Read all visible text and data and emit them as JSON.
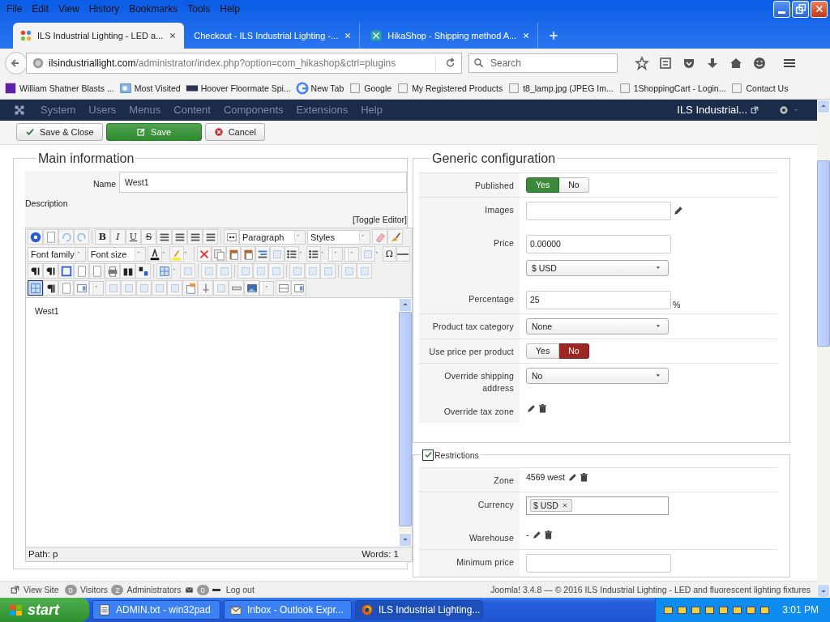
{
  "browser": {
    "menu": [
      "File",
      "Edit",
      "View",
      "History",
      "Bookmarks",
      "Tools",
      "Help"
    ],
    "tabs": [
      {
        "title": "ILS Industrial Lighting - LED a...",
        "kind": "joomla",
        "selected": true
      },
      {
        "title": "Checkout - ILS Industrial Lighting -...",
        "kind": "blank",
        "selected": false
      },
      {
        "title": "HikaShop - Shipping method A...",
        "kind": "hikashop",
        "selected": false
      }
    ],
    "url_host": "ilsindustriallight.com",
    "url_path": "/administrator/index.php?option=com_hikashop&ctrl=plugins",
    "search_placeholder": "Search",
    "bookmarks": [
      {
        "label": "William Shatner Blasts ...",
        "kind": "yahoo"
      },
      {
        "label": "Most Visited",
        "kind": "folder"
      },
      {
        "label": "Hoover Floormate Spi...",
        "kind": "hoover"
      },
      {
        "label": "New Tab",
        "kind": "google"
      },
      {
        "label": "Google",
        "kind": "blank"
      },
      {
        "label": "My Registered Products",
        "kind": "blank"
      },
      {
        "label": "t8_lamp.jpg (JPEG Im...",
        "kind": "blank"
      },
      {
        "label": "1ShoppingCart - Login...",
        "kind": "blank"
      },
      {
        "label": "Contact Us",
        "kind": "blank"
      }
    ]
  },
  "admin": {
    "menu": [
      "System",
      "Users",
      "Menus",
      "Content",
      "Components",
      "Extensions",
      "Help"
    ],
    "site_link": "ILS Industrial..."
  },
  "toolbar": [
    {
      "label": "Save & Close",
      "kind": "save-close"
    },
    {
      "label": "Save",
      "kind": "save"
    },
    {
      "label": "Cancel",
      "kind": "cancel"
    }
  ],
  "main": {
    "legend": "Main information",
    "name_label": "Name",
    "name_value": "West1",
    "description_label": "Description",
    "toggle_editor": "[Toggle Editor]",
    "editor": {
      "glyphs": [
        "B",
        "I",
        "U",
        "S",
        "Ω"
      ],
      "selects": [
        "Paragraph",
        "Styles",
        "Font family",
        "Font size"
      ],
      "visual_aid_on": true,
      "content": "West1",
      "path": "Path: p",
      "words": "Words: 1"
    }
  },
  "generic": {
    "legend": "Generic configuration",
    "groups": [
      [
        {
          "label": "Published",
          "kind": "toggle",
          "options": [
            {
              "label": "Yes",
              "selected": true
            },
            {
              "label": "No",
              "selected": false
            }
          ]
        }
      ],
      [
        {
          "label": "Images",
          "kind": "image-input"
        },
        {
          "label": "Price",
          "kind": "price",
          "value": "0.00000",
          "currency": "$ USD"
        },
        {
          "label": "Percentage",
          "kind": "input",
          "value": "25",
          "suffix": "%"
        }
      ],
      [
        {
          "label": "Product tax category",
          "kind": "select",
          "value": "None"
        }
      ],
      [
        {
          "label": "Use price per product",
          "kind": "toggle",
          "options": [
            {
              "label": "Yes",
              "selected": false
            },
            {
              "label": "No",
              "selected": true
            }
          ]
        }
      ],
      [
        {
          "label": "Override shipping address",
          "kind": "select",
          "value": "No"
        },
        {
          "label": "Override tax zone",
          "kind": "actions"
        }
      ]
    ]
  },
  "restrictions": {
    "label": "Restrictions",
    "checked": true,
    "groups": [
      [
        {
          "label": "Zone",
          "kind": "actions",
          "value": "4569 west"
        }
      ],
      [
        {
          "label": "Currency",
          "kind": "tags",
          "tags": [
            "$ USD"
          ]
        },
        {
          "label": "Warehouse",
          "kind": "actions",
          "value": "-"
        }
      ],
      [
        {
          "label": "Minimum price",
          "kind": "input"
        }
      ]
    ]
  },
  "footer": {
    "view_site": "View Site",
    "visitors_count": "0",
    "visitors": "Visitors",
    "admins_count": "2",
    "admins": "Administrators",
    "messages_count": "0",
    "logout": "Log out",
    "credits": "Joomla! 3.4.8  —  © 2016 ILS Industrial Lighting - LED and fluorescent lighting fixtures"
  },
  "taskbar": {
    "start": "start",
    "items": [
      {
        "label": "ADMIN.txt - win32pad",
        "kind": "notepad",
        "selected": false
      },
      {
        "label": "Inbox - Outlook Expr...",
        "kind": "mail",
        "selected": false
      },
      {
        "label": "ILS Industrial Lighting...",
        "kind": "firefox",
        "selected": true
      }
    ],
    "clock": "3:01 PM"
  }
}
